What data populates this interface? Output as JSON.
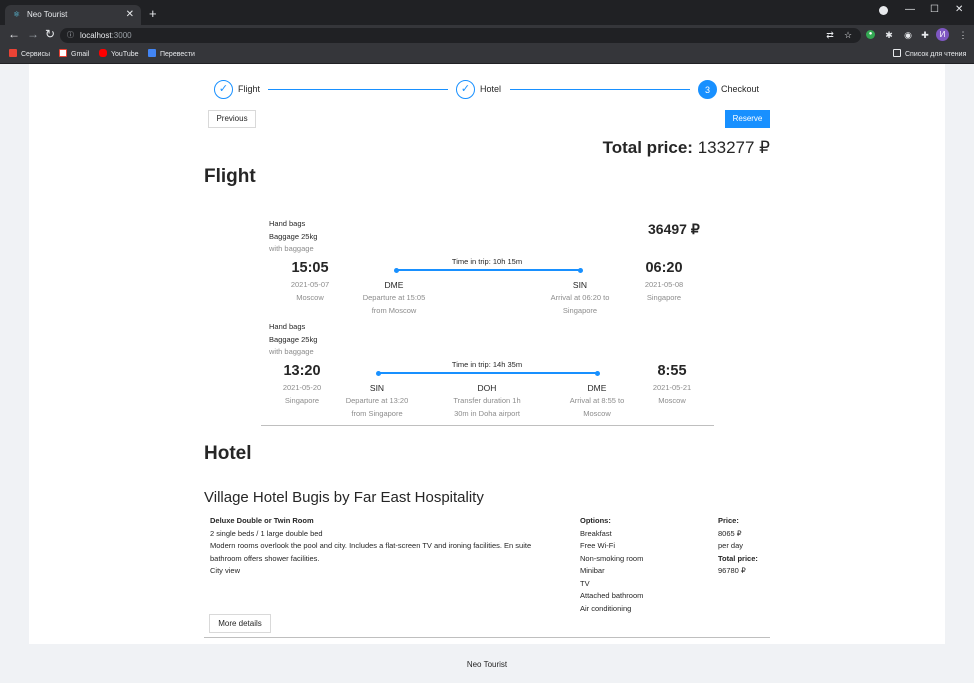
{
  "browser": {
    "tab_title": "Neo Tourist",
    "tab_close": "✕",
    "new_tab": "+",
    "url_host": "localhost",
    "url_port": ":3000",
    "profile_initial": "И",
    "bookmarks": [
      "Сервисы",
      "Gmail",
      "YouTube",
      "Перевести"
    ],
    "reading_list": "Список для чтения"
  },
  "steps": [
    {
      "label": "Flight",
      "state": "done"
    },
    {
      "label": "Hotel",
      "state": "done"
    },
    {
      "label": "Checkout",
      "state": "active",
      "number": "3"
    }
  ],
  "buttons": {
    "previous": "Previous",
    "reserve": "Reserve",
    "more_details": "More details"
  },
  "total": {
    "label": "Total price:",
    "value": "133277 ₽"
  },
  "flight": {
    "heading": "Flight",
    "segments": [
      {
        "bags": [
          "Hand bags",
          "Baggage 25kg"
        ],
        "with_baggage": "with baggage",
        "price": "36497 ₽",
        "dep_time": "15:05",
        "dep_date": "2021-05-07",
        "dep_city": "Moscow",
        "arr_time": "06:20",
        "arr_date": "2021-05-08",
        "arr_city": "Singapore",
        "trip_time": "Time in trip: 10h 15m",
        "from_code": "DME",
        "from_desc_1": "Departure at 15:05",
        "from_desc_2": "from Moscow",
        "to_code": "SIN",
        "to_desc_1": "Arrival at 06:20 to",
        "to_desc_2": "Singapore"
      },
      {
        "bags": [
          "Hand bags",
          "Baggage 25kg"
        ],
        "with_baggage": "with baggage",
        "dep_time": "13:20",
        "dep_date": "2021-05-20",
        "dep_city": "Singapore",
        "arr_time": "8:55",
        "arr_date": "2021-05-21",
        "arr_city": "Moscow",
        "trip_time": "Time in trip: 14h 35m",
        "from_code": "SIN",
        "from_desc_1": "Departure at 13:20",
        "from_desc_2": "from Singapore",
        "via_code": "DOH",
        "via_desc_1": "Transfer duration 1h",
        "via_desc_2": "30m in Doha airport",
        "to_code": "DME",
        "to_desc_1": "Arrival at 8:55 to",
        "to_desc_2": "Moscow"
      }
    ]
  },
  "hotel": {
    "heading": "Hotel",
    "name": "Village Hotel Bugis by Far East Hospitality",
    "room_title": "Deluxe Double or Twin Room",
    "beds": "2 single beds / 1 large double bed",
    "desc_1": "Modern rooms overlook the pool and city. Includes a flat-screen TV and ironing facilities. En suite",
    "desc_2": "bathroom offers shower facilities.",
    "view": "City view",
    "options_label": "Options:",
    "options": [
      "Breakfast",
      "Free Wi-Fi",
      "Non-smoking room",
      "Minibar",
      "TV",
      "Attached bathroom",
      "Air conditioning"
    ],
    "price_label": "Price:",
    "price_value": "8065 ₽",
    "price_unit": "per day",
    "total_label": "Total price:",
    "total_value": "96780 ₽"
  },
  "footer": "Neo Tourist",
  "colors": {
    "accent": "#1890ff",
    "page_bg": "#f0f2f5",
    "chrome_dark": "#202124"
  }
}
